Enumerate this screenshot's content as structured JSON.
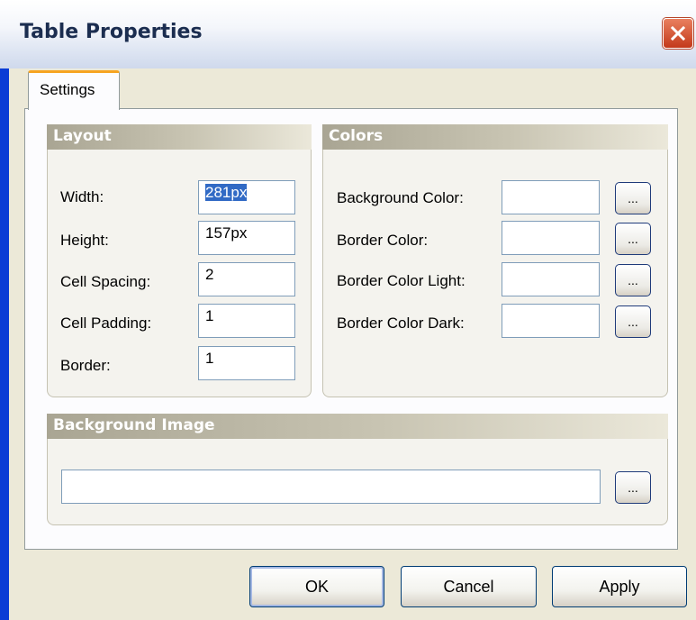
{
  "window": {
    "title": "Table Properties",
    "close_icon": "close-icon"
  },
  "tabs": [
    {
      "label": "Settings",
      "active": true
    }
  ],
  "layout": {
    "header": "Layout",
    "fields": [
      {
        "label": "Width:",
        "value": "281px",
        "selected": true
      },
      {
        "label": "Height:",
        "value": "157px"
      },
      {
        "label": "Cell Spacing:",
        "value": "2"
      },
      {
        "label": "Cell Padding:",
        "value": "1"
      },
      {
        "label": "Border:",
        "value": "1"
      }
    ]
  },
  "colors": {
    "header": "Colors",
    "fields": [
      {
        "label": "Background Color:",
        "value": "",
        "browse": "..."
      },
      {
        "label": "Border Color:",
        "value": "",
        "browse": "..."
      },
      {
        "label": "Border Color Light:",
        "value": "",
        "browse": "..."
      },
      {
        "label": "Border Color Dark:",
        "value": "",
        "browse": "..."
      }
    ]
  },
  "background_image": {
    "header": "Background Image",
    "value": "",
    "browse": "..."
  },
  "buttons": {
    "ok": "OK",
    "cancel": "Cancel",
    "apply": "Apply"
  },
  "theme": {
    "accent": "#0a3cd5",
    "tab_highlight": "#f6a421",
    "close_red": "#c3391a"
  }
}
